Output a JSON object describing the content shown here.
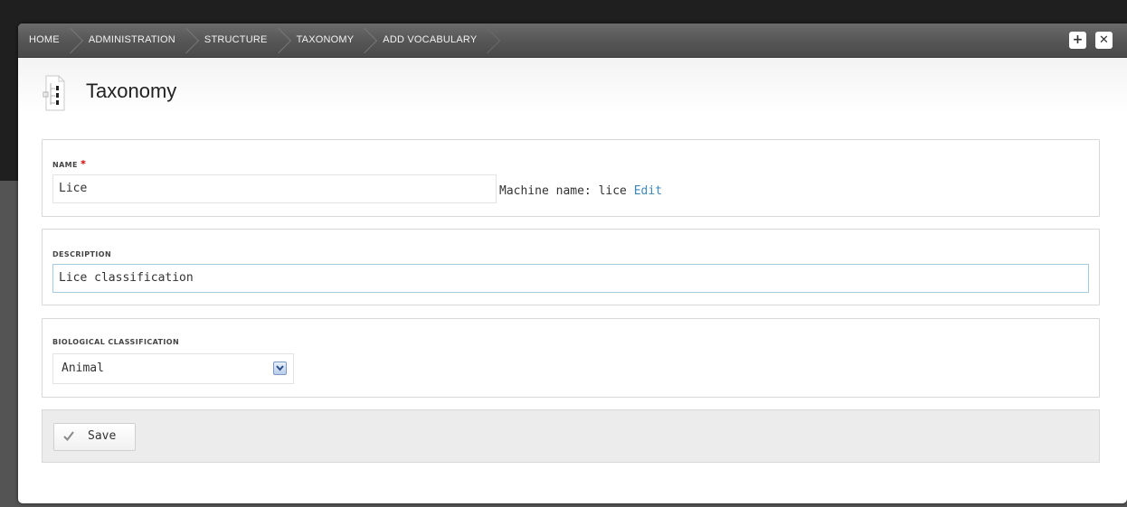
{
  "breadcrumb": [
    "HOME",
    "ADMINISTRATION",
    "STRUCTURE",
    "TAXONOMY",
    "ADD VOCABULARY"
  ],
  "toolbar": {
    "add_icon": "plus-icon",
    "close_icon": "close-icon"
  },
  "header": {
    "title": "Taxonomy",
    "icon": "taxonomy-tree-icon"
  },
  "name_field": {
    "label": "NAME",
    "required_marker": "*",
    "value": "Lice",
    "machine_name_prefix": "Machine name: lice",
    "machine_name_edit": "Edit"
  },
  "description_field": {
    "label": "DESCRIPTION",
    "value": "Lice classification"
  },
  "classification_field": {
    "label": "BIOLOGICAL CLASSIFICATION",
    "selected": "Animal"
  },
  "actions": {
    "save_label": "Save"
  },
  "colors": {
    "link": "#3d88b8",
    "required": "#d40000",
    "toolbar": "#555555",
    "actions_bg": "#ececec"
  }
}
